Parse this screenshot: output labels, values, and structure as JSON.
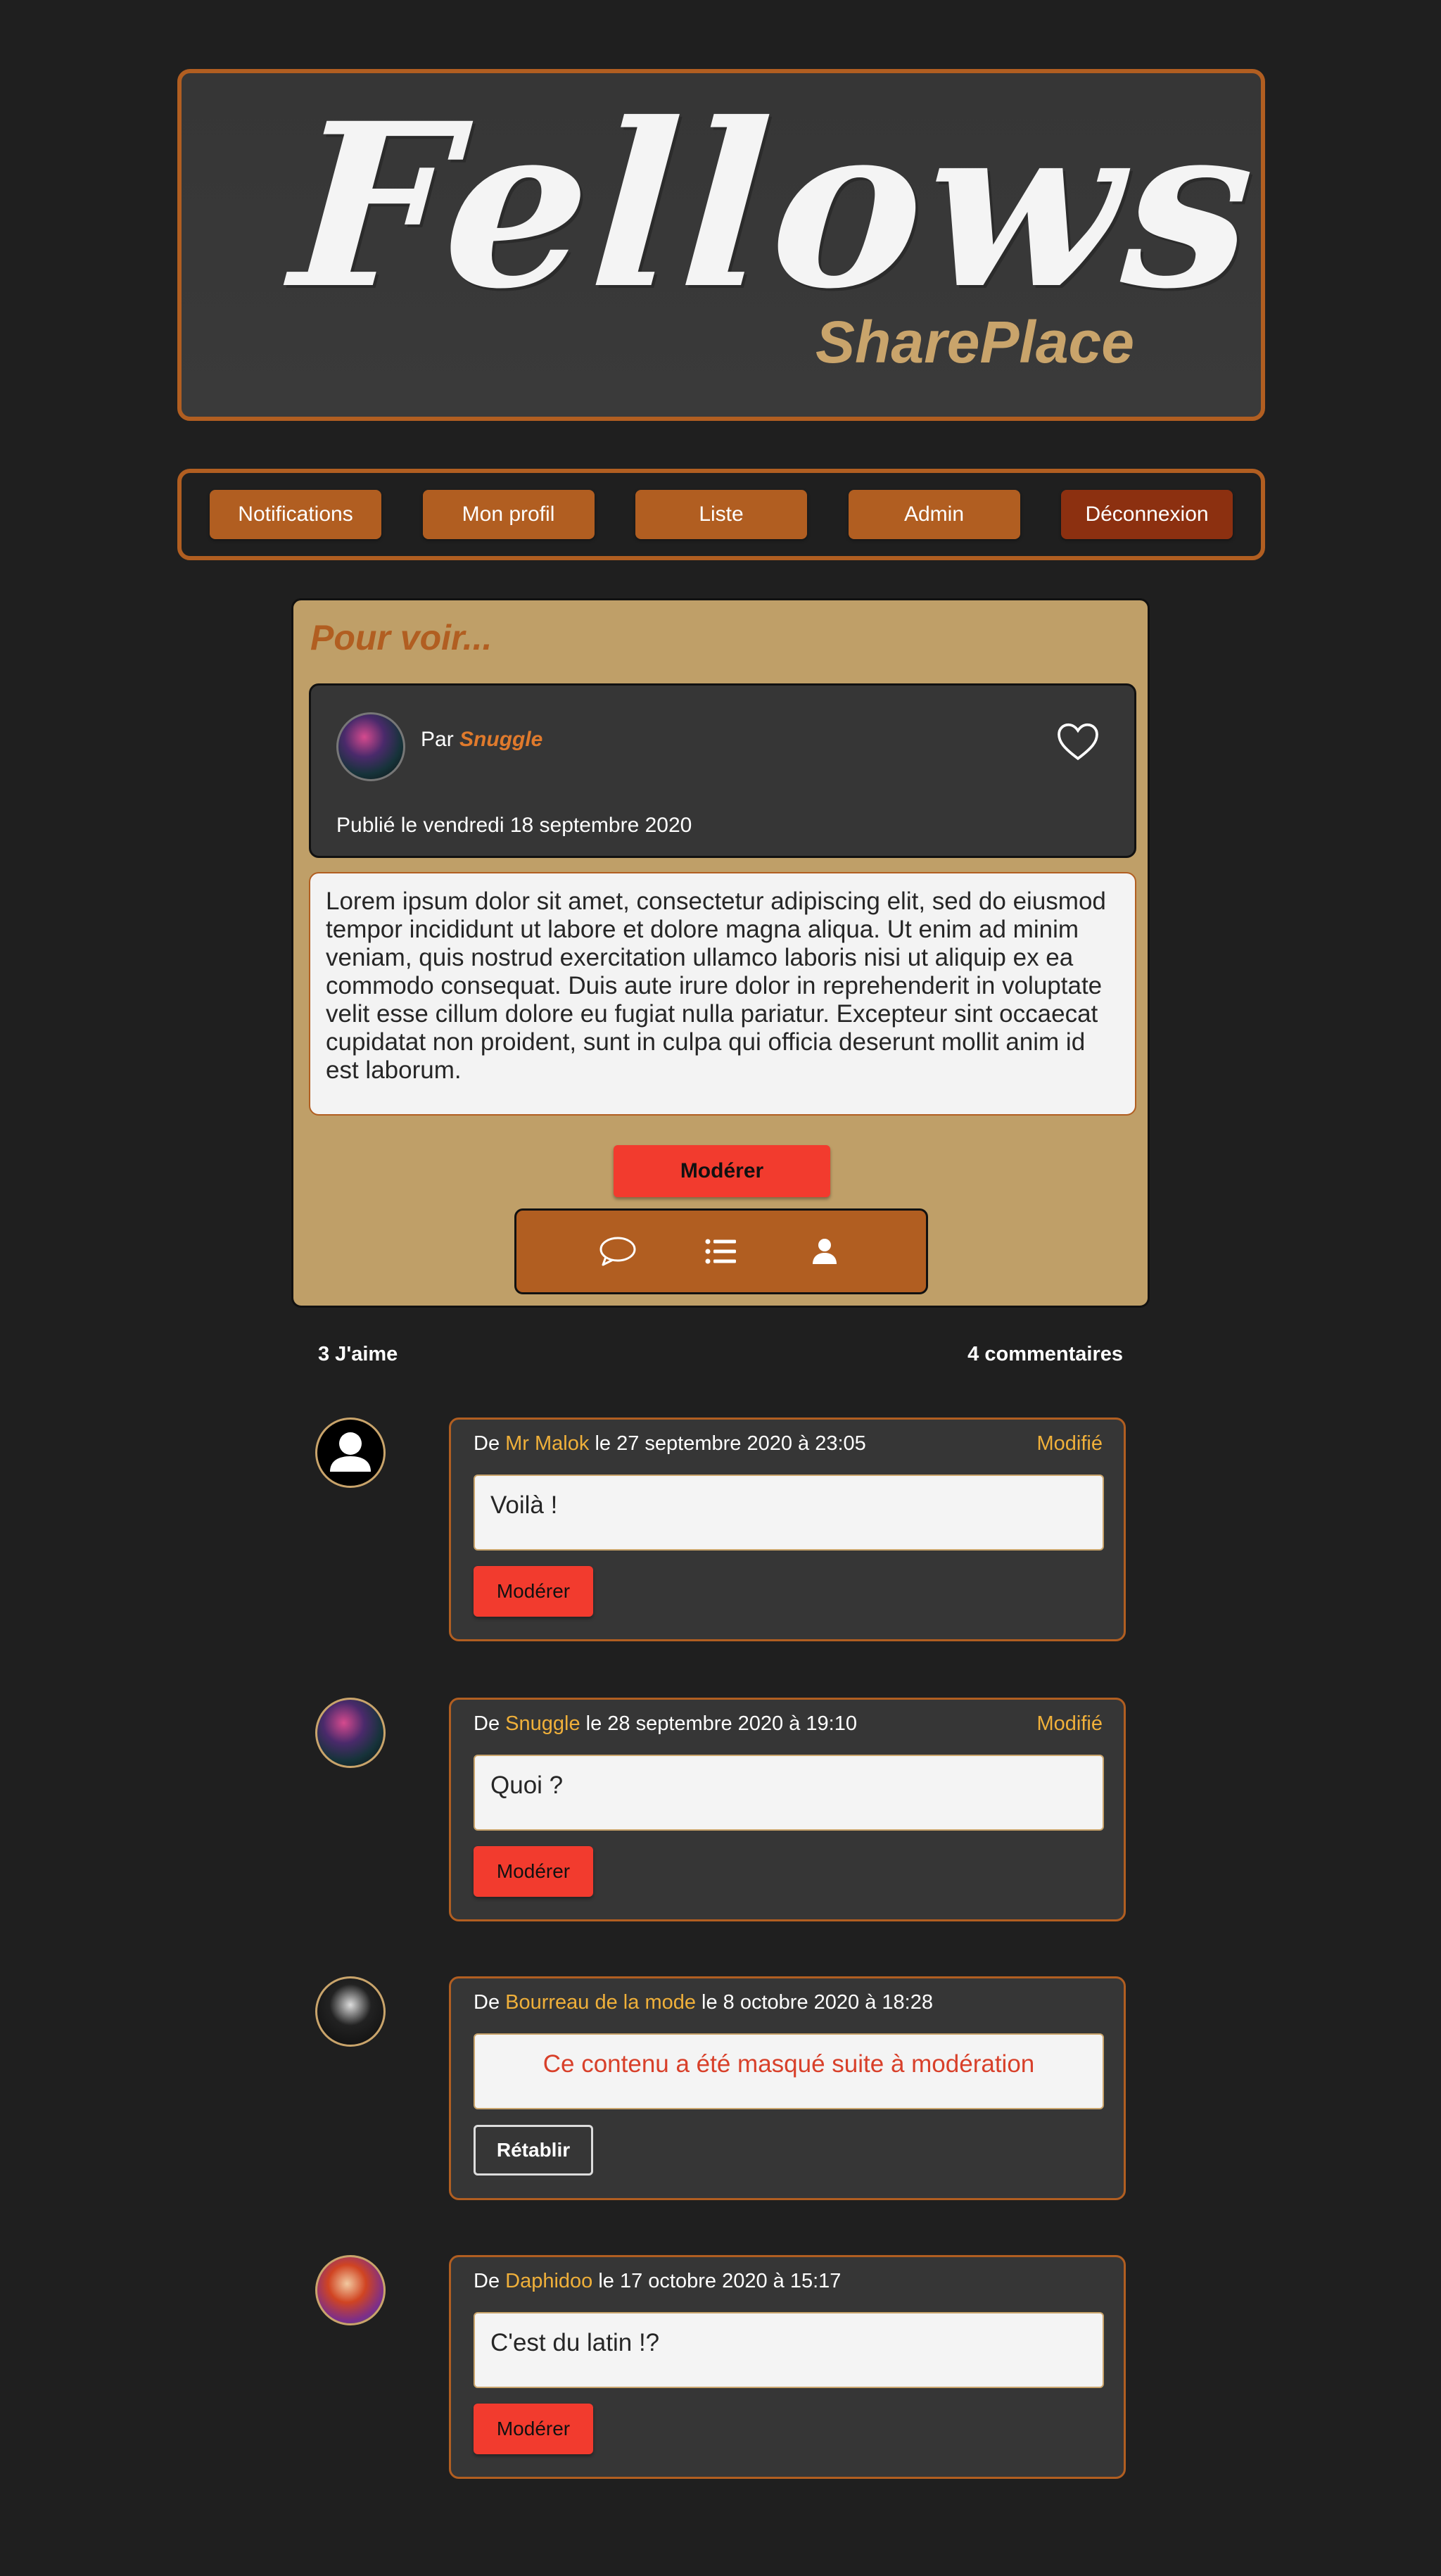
{
  "header": {
    "title": "Fellows",
    "subtitle": "SharePlace"
  },
  "nav": {
    "items": [
      "Notifications",
      "Mon profil",
      "Liste",
      "Admin",
      "Déconnexion"
    ]
  },
  "post": {
    "title": "Pour voir...",
    "by_prefix": "Par",
    "author": "Snuggle",
    "date": "Publié le vendredi 18 septembre 2020",
    "body": "Lorem ipsum dolor sit amet, consectetur adipiscing elit, sed do eiusmod tempor incididunt ut labore et dolore magna aliqua. Ut enim ad minim veniam, quis nostrud exercitation ullamco laboris nisi ut aliquip ex ea commodo consequat. Duis aute irure dolor in reprehenderit in voluptate velit esse cillum dolore eu fugiat nulla pariatur. Excepteur sint occaecat cupidatat non proident, sunt in culpa qui officia deserunt mollit anim id est laborum.",
    "moderate_label": "Modérer",
    "tools": [
      "comment-icon",
      "list-icon",
      "user-icon"
    ]
  },
  "stats": {
    "likes": "3 J'aime",
    "comments": "4 commentaires"
  },
  "comments": [
    {
      "prefix": "De",
      "author": "Mr Malok",
      "date": "le 27 septembre 2020 à 23:05",
      "modified": "Modifié",
      "text": "Voilà !",
      "button": "Modérer"
    },
    {
      "prefix": "De",
      "author": "Snuggle",
      "date": "le 28 septembre 2020 à 19:10",
      "modified": "Modifié",
      "text": "Quoi ?",
      "button": "Modérer"
    },
    {
      "prefix": "De",
      "author": "Bourreau de la mode",
      "date": "le 8 octobre 2020 à 18:28",
      "modified": "",
      "text": "Ce contenu a été masqué suite à modération",
      "button": "Rétablir"
    },
    {
      "prefix": "De",
      "author": "Daphidoo",
      "date": "le 17 octobre 2020 à 15:17",
      "modified": "",
      "text": "C'est du latin !?",
      "button": "Modérer"
    }
  ],
  "colors": {
    "background": "#1f1f1f",
    "accent": "#b15e21",
    "card": "#bf9f68",
    "danger": "#f23b2e",
    "highlight": "#f0b03a"
  }
}
